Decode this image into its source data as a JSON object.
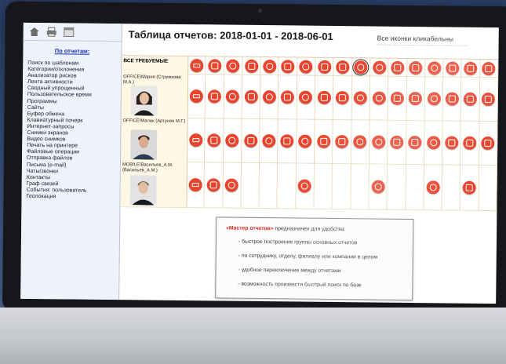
{
  "colors": {
    "accent": "#e8452e",
    "sidebar_bg": "#eef2fb",
    "label_bg": "#fdf7e4",
    "highlight": "#d5241c"
  },
  "toolbar": {
    "icons": [
      "home-icon",
      "printer-icon",
      "window-icon"
    ]
  },
  "sidebar": {
    "title": "По отчетам:",
    "items": [
      "Поиск по шаблонам",
      "Категории/отклонения",
      "Анализатор рисков",
      "Лента активности",
      "Сводный упрощенный",
      "Пользовательское время",
      "Программы",
      "Сайты",
      "Буфер обмена",
      "Клавиатурный почерк",
      "Интернет-запросы",
      "Снимки экранов",
      "Видео снимков",
      "Печать на принтере",
      "Файловые операции",
      "Отправка файлов",
      "Письма (e-mail)",
      "Чаты/звонки",
      "Контакты",
      "Граф связей",
      "События: пользователь",
      "Геолокация"
    ]
  },
  "main": {
    "title": "Таблица отчетов: 2018-01-01 - 2018-06-01",
    "hint": "Все иконки кликабельны",
    "header_label": "ВСЕ ТРЕБУЕМЫЕ"
  },
  "employees": [
    {
      "name": "OFFICE\\Мария (Стрижкова М.А.)",
      "icons": [
        1,
        1,
        1,
        1,
        1,
        1,
        1,
        1,
        1,
        1,
        1,
        1,
        1,
        1,
        1,
        1,
        1
      ]
    },
    {
      "name": "OFFICE\\Малик (Артунян М.Г.)",
      "icons": [
        1,
        1,
        1,
        1,
        1,
        1,
        1,
        1,
        1,
        1,
        1,
        1,
        1,
        1,
        1,
        1,
        1
      ]
    },
    {
      "name": "MOBILE\\Васильев_А.М. (Васильев_А.М.)",
      "icons": [
        1,
        1,
        1,
        0,
        0,
        0,
        1,
        0,
        0,
        0,
        1,
        0,
        0,
        1,
        0,
        1,
        0
      ]
    }
  ],
  "infobox": {
    "brand": "«Мастер отчетов»",
    "lead": " предназначен для удобства:",
    "bullets": [
      "- быстрое построение группы основных отчетов",
      "- по сотруднику, отделу, филиалу или компании в целом",
      "- удобное переключение между отчетами",
      "- возможность произвести быстрый поиск по базе"
    ]
  }
}
